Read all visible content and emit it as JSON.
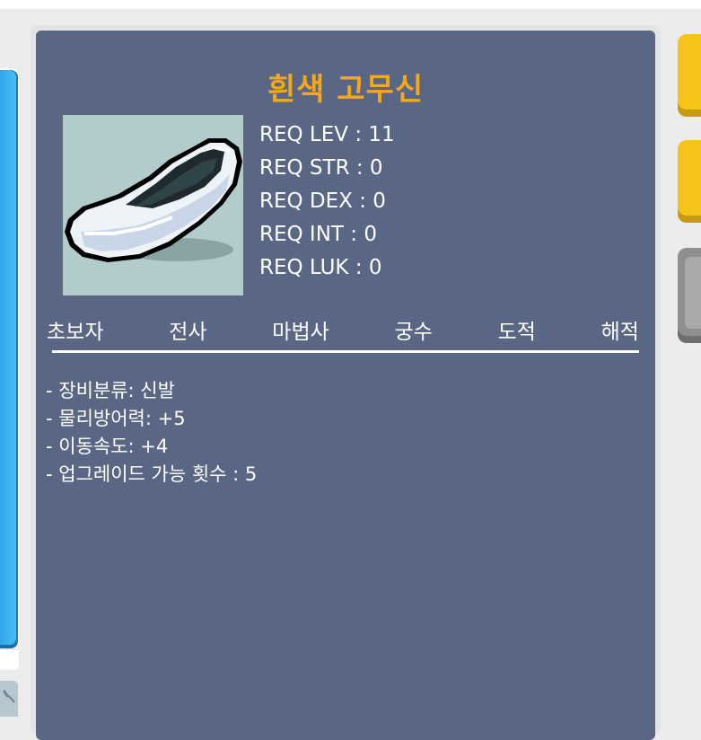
{
  "item": {
    "name": "흰색 고무신",
    "icon": "white-rubber-shoe-icon"
  },
  "requirements": [
    "REQ LEV : 11",
    "REQ STR : 0",
    "REQ DEX : 0",
    "REQ INT : 0",
    "REQ LUK : 0"
  ],
  "jobs": [
    "초보자",
    "전사",
    "마법사",
    "궁수",
    "도적",
    "해적"
  ],
  "stats": [
    "- 장비분류: 신발",
    "- 물리방어력: +5",
    "- 이동속도: +4",
    "- 업그레이드 가능 횟수 : 5"
  ],
  "colors": {
    "panel": "#5a6784",
    "title": "#f5a81c",
    "item_bg": "#b3cbcb",
    "left_scroll": "#3fb4f0",
    "side_button_yellow": "#f6c418",
    "side_button_gray": "#8f8f8f"
  }
}
